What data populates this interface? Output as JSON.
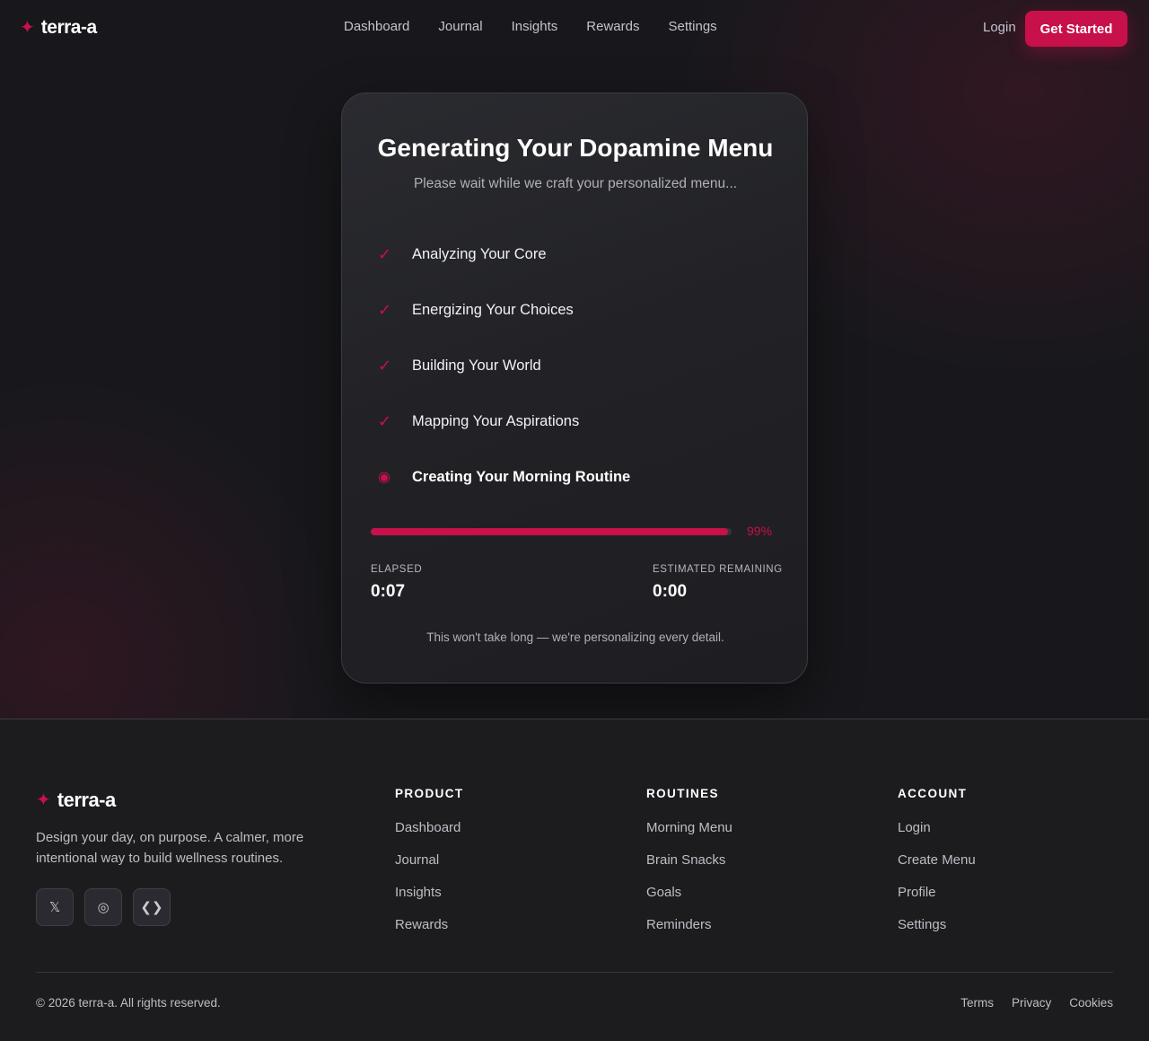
{
  "brand": {
    "name": "terra-a",
    "icon": "sparkle-star-icon",
    "accent_color": "#c8104a"
  },
  "nav": {
    "links": [
      "Dashboard",
      "Journal",
      "Insights",
      "Rewards",
      "Settings"
    ],
    "login_label": "Login",
    "cta_label": "Get Started"
  },
  "card": {
    "title": "Generating Your Dopamine Menu",
    "subtitle": "Please wait while we craft your personalized menu...",
    "steps": [
      {
        "label": "Analyzing Your Core",
        "status": "done",
        "mark": "✓"
      },
      {
        "label": "Energizing Your Choices",
        "status": "done",
        "mark": "✓"
      },
      {
        "label": "Building Your World",
        "status": "done",
        "mark": "✓"
      },
      {
        "label": "Mapping Your Aspirations",
        "status": "done",
        "mark": "✓"
      },
      {
        "label": "Creating Your Morning Routine",
        "status": "in-progress",
        "mark": "◉"
      }
    ],
    "progress": {
      "percent": 99,
      "percent_label": "99%"
    },
    "elapsed": {
      "label": "ELAPSED",
      "value": "0:07"
    },
    "remaining": {
      "label": "ESTIMATED REMAINING",
      "value": "0:00"
    },
    "note": "This won't take long — we're personalizing every detail."
  },
  "footer": {
    "brand_name": "terra-a",
    "tagline": "Design your day, on purpose. A calmer, more intentional way to build wellness routines.",
    "socials": [
      {
        "icon": "x-twitter-icon",
        "glyph": "𝕏"
      },
      {
        "icon": "instagram-icon",
        "glyph": "◎"
      },
      {
        "icon": "code-icon",
        "glyph": "❮❯"
      }
    ],
    "columns": [
      {
        "heading": "PRODUCT",
        "links": [
          "Dashboard",
          "Journal",
          "Insights",
          "Rewards"
        ]
      },
      {
        "heading": "ROUTINES",
        "links": [
          "Morning Menu",
          "Brain Snacks",
          "Goals",
          "Reminders"
        ]
      },
      {
        "heading": "ACCOUNT",
        "links": [
          "Login",
          "Create Menu",
          "Profile",
          "Settings"
        ]
      }
    ],
    "copyright": "© 2026 terra-a. All rights reserved.",
    "legal_links": [
      "Terms",
      "Privacy",
      "Cookies"
    ]
  }
}
